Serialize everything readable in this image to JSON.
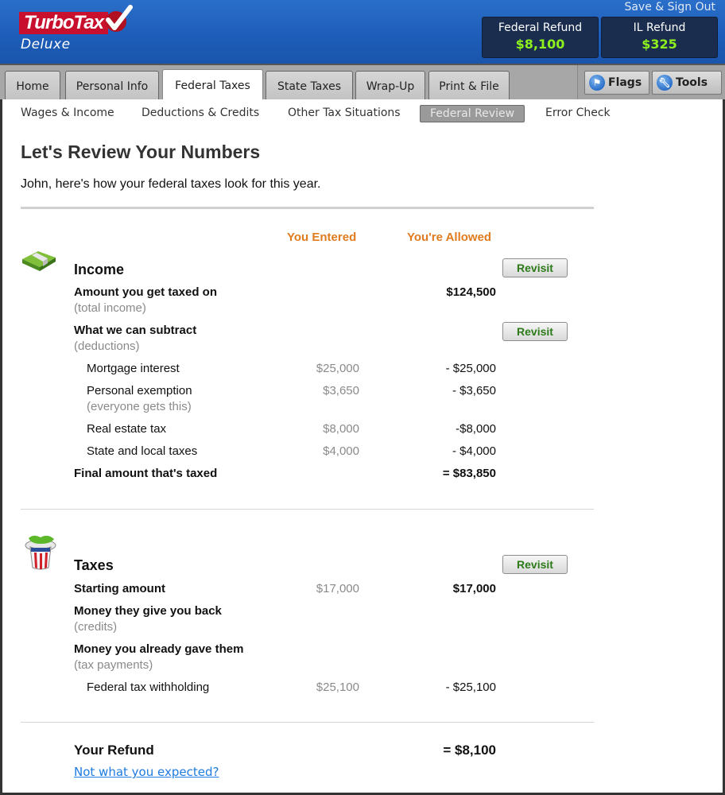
{
  "header": {
    "brand": "TurboTax",
    "edition": "Deluxe",
    "save_sign_out": "Save & Sign Out",
    "refunds": [
      {
        "label": "Federal Refund",
        "amount": "$8,100"
      },
      {
        "label": "IL Refund",
        "amount": "$325"
      }
    ]
  },
  "tabs": [
    {
      "label": "Home",
      "active": false
    },
    {
      "label": "Personal Info",
      "active": false
    },
    {
      "label": "Federal Taxes",
      "active": true
    },
    {
      "label": "State Taxes",
      "active": false
    },
    {
      "label": "Wrap-Up",
      "active": false
    },
    {
      "label": "Print & File",
      "active": false
    }
  ],
  "tools": {
    "flags": "Flags",
    "tools": "Tools"
  },
  "subnav": [
    {
      "label": "Wages & Income",
      "active": false
    },
    {
      "label": "Deductions & Credits",
      "active": false
    },
    {
      "label": "Other Tax Situations",
      "active": false
    },
    {
      "label": "Federal Review",
      "active": true
    },
    {
      "label": "Error Check",
      "active": false
    }
  ],
  "page": {
    "title": "Let's Review Your Numbers",
    "intro": "John, here's how your federal taxes look for this year.",
    "col_entered": "You Entered",
    "col_allowed": "You're Allowed",
    "revisit_label": "Revisit"
  },
  "income": {
    "title": "Income",
    "taxed_on": {
      "label": "Amount you get taxed on",
      "sub": "(total income)",
      "allowed": "$124,500"
    },
    "subtract": {
      "label": "What we can subtract",
      "sub": "(deductions)"
    },
    "deductions": [
      {
        "label": "Mortgage interest",
        "sub": "",
        "entered": "$25,000",
        "allowed": "- $25,000"
      },
      {
        "label": "Personal exemption",
        "sub": "(everyone gets this)",
        "entered": "$3,650",
        "allowed": "- $3,650"
      },
      {
        "label": "Real estate tax",
        "sub": "",
        "entered": "$8,000",
        "allowed": "-$8,000"
      },
      {
        "label": "State and local taxes",
        "sub": "",
        "entered": "$4,000",
        "allowed": "- $4,000"
      }
    ],
    "final": {
      "label": "Final amount that's taxed",
      "allowed": "= $83,850"
    }
  },
  "taxes": {
    "title": "Taxes",
    "starting": {
      "label": "Starting amount",
      "entered": "$17,000",
      "allowed": "$17,000"
    },
    "credits": {
      "label": "Money they give you back",
      "sub": "(credits)"
    },
    "payments": {
      "label": "Money you already gave them",
      "sub": "(tax payments)"
    },
    "withholding": {
      "label": "Federal tax withholding",
      "entered": "$25,100",
      "allowed": "- $25,100"
    }
  },
  "refund": {
    "label": "Your Refund",
    "amount": "= $8,100",
    "link": "Not what you expected?"
  },
  "colors": {
    "header_blue": "#1d5cb8",
    "refund_green": "#8df01e",
    "column_orange": "#e07b1f",
    "revisit_green": "#2d7a1a",
    "link_blue": "#1e7be0"
  }
}
